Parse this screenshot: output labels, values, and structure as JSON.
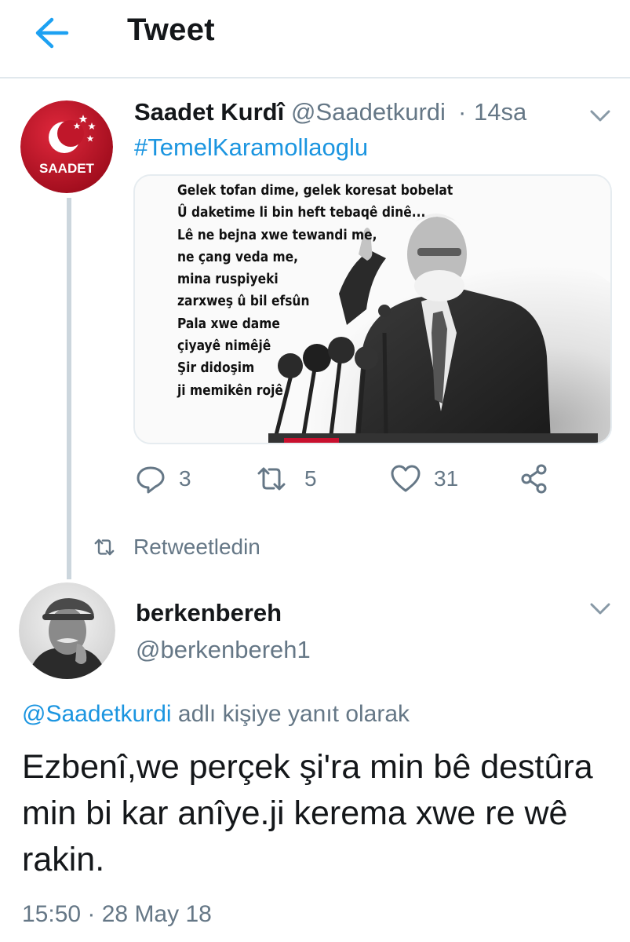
{
  "header": {
    "title": "Tweet",
    "back_icon": "back-arrow-icon",
    "accent": "#1da1f2"
  },
  "tweet1": {
    "author_name": "Saadet Kurdî",
    "author_handle": "@Saadetkurdi",
    "separator": "·",
    "time": "14sa",
    "hashtag": "#TemelKaramollaoglu",
    "avatar_text": "SAADET",
    "avatar_color": "#c8102e",
    "poem": "Gelek tofan dime, gelek koresat bobelat\nÛ daketime li bin heft tebaqê dinê...\nLê ne bejna xwe tewandi me,\nne çang veda me,\nmina ruspiyeki\nzarxweş û bil efsûn\nPala xwe dame\nçiyayê nimêjê\nŞir didoşim\nji memikên rojê",
    "actions": {
      "reply_count": "3",
      "retweet_count": "5",
      "like_count": "31"
    }
  },
  "retweet_context": {
    "label": "Retweetledin"
  },
  "tweet2": {
    "author_name": "berkenbereh",
    "author_handle": "@berkenbereh1",
    "reply_to_handle": "@Saadetkurdi",
    "reply_to_suffix": " adlı kişiye yanıt olarak",
    "body": "Ezbenî,we perçek şi'ra min bê destûra min bi kar anîye.ji kerema xwe re wê rakin.",
    "timestamp": "15:50 · 28 May 18"
  },
  "colors": {
    "link": "#1b95e0",
    "secondary_text": "#657786",
    "primary_text": "#14171a",
    "divider": "#e1e8ed"
  }
}
